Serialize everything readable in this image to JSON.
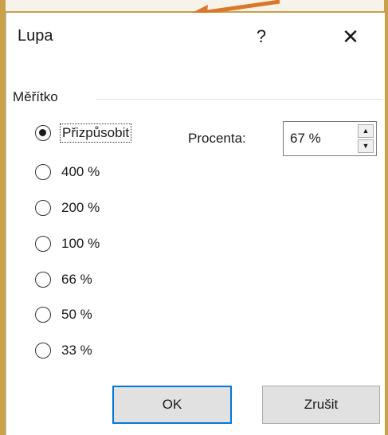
{
  "dialog": {
    "title": "Lupa",
    "help_label": "?",
    "close_label": "✕"
  },
  "group": {
    "label": "Měřítko"
  },
  "options": [
    {
      "label": "Přizpůsobit",
      "checked": true
    },
    {
      "label": "400 %",
      "checked": false
    },
    {
      "label": "200 %",
      "checked": false
    },
    {
      "label": "100 %",
      "checked": false
    },
    {
      "label": "66 %",
      "checked": false
    },
    {
      "label": "50 %",
      "checked": false
    },
    {
      "label": "33 %",
      "checked": false
    }
  ],
  "percent": {
    "label": "Procenta:",
    "value": "67 %",
    "up_icon": "▲",
    "down_icon": "▼"
  },
  "buttons": {
    "ok": "OK",
    "cancel": "Zrušit"
  },
  "colors": {
    "accent": "#0078d7",
    "frame": "#c9a14a",
    "arrow": "#d9772a"
  },
  "icons": {
    "help": "help-icon",
    "close": "close-icon",
    "spin_up": "chevron-up-icon",
    "spin_down": "chevron-down-icon",
    "pointer_arrow": "arrow-icon"
  }
}
